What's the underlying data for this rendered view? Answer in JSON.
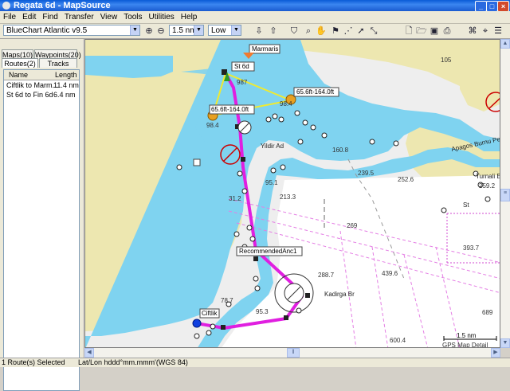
{
  "window": {
    "title": "Regata 6d - MapSource"
  },
  "menu": [
    "File",
    "Edit",
    "Find",
    "Transfer",
    "View",
    "Tools",
    "Utilities",
    "Help"
  ],
  "toolbar": {
    "product": "BlueChart Atlantic v9.5",
    "zoom": "1.5 nm",
    "detail": "Low"
  },
  "left_panel": {
    "tabs_top": [
      "Maps(10)",
      "Waypoints(20)"
    ],
    "tabs_bottom": [
      "Routes(2)",
      "Tracks"
    ],
    "columns": [
      "Name",
      "Length"
    ],
    "routes": [
      {
        "name": "Ciftlik to Marm...",
        "length": "11.4 nm"
      },
      {
        "name": "St 6d to Fin 6d",
        "length": "6.4 nm"
      }
    ]
  },
  "map": {
    "labels": {
      "marmaris": "Marmaris",
      "st6d": "St 6d",
      "wp1": "65.6ft-164.0ft",
      "wp2": "65.6ft-164.0ft",
      "recommended": "RecommendedAnc1",
      "ciftlik": "Ciftlik",
      "kadirga": "Kadirga Br",
      "yildir": "Yildir Ad",
      "apagos": "Apagos Burnu Pe",
      "turnali": "Turnali E",
      "st": "St"
    },
    "depths": [
      "105",
      "98.4",
      "160.8",
      "239.5",
      "252.6",
      "259.2",
      "213.3",
      "269",
      "95.1",
      "31.2",
      "288.7",
      "439.6",
      "393.7",
      "78.7",
      "95.3",
      "600.4",
      "689",
      "987",
      "98.4"
    ],
    "scale": "1.5 nm",
    "detail_note": "GPS Map Detail"
  },
  "status": {
    "selection": "1 Route(s) Selected",
    "coords": "Lat/Lon hddd°mm.mmm'(WGS 84)"
  },
  "colors": {
    "land": "#ede7b0",
    "shallow": "#66ccee",
    "route": "#e01fe0",
    "leg": "#f0ea30"
  }
}
